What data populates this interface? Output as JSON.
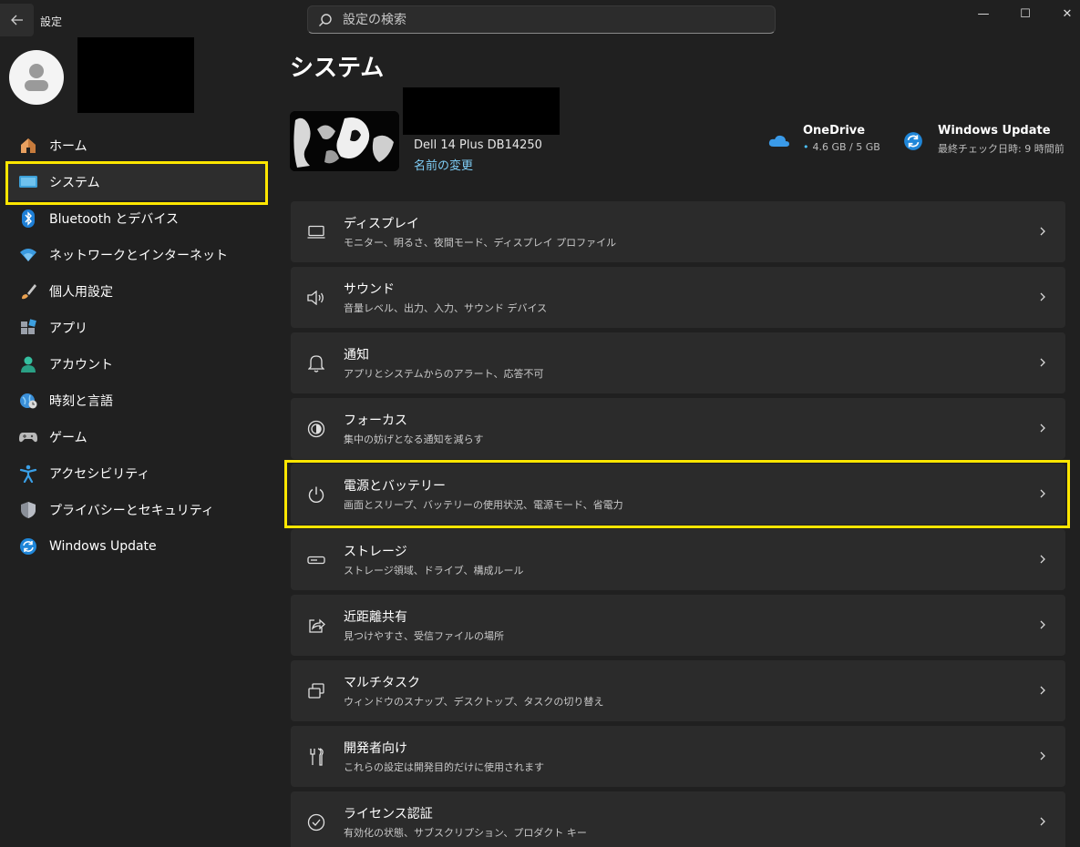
{
  "window": {
    "title": "設定",
    "controls": {
      "minimize": "—",
      "maximize": "☐",
      "close": "✕"
    }
  },
  "search": {
    "placeholder": "設定の検索"
  },
  "sidebar": {
    "items": [
      {
        "label": "ホーム",
        "icon": "home-icon"
      },
      {
        "label": "システム",
        "icon": "system-icon",
        "active": true
      },
      {
        "label": "Bluetooth とデバイス",
        "icon": "bluetooth-icon"
      },
      {
        "label": "ネットワークとインターネット",
        "icon": "wifi-icon"
      },
      {
        "label": "個人用設定",
        "icon": "brush-icon"
      },
      {
        "label": "アプリ",
        "icon": "apps-icon"
      },
      {
        "label": "アカウント",
        "icon": "account-icon"
      },
      {
        "label": "時刻と言語",
        "icon": "globe-icon"
      },
      {
        "label": "ゲーム",
        "icon": "gamepad-icon"
      },
      {
        "label": "アクセシビリティ",
        "icon": "accessibility-icon"
      },
      {
        "label": "プライバシーとセキュリティ",
        "icon": "shield-icon"
      },
      {
        "label": "Windows Update",
        "icon": "update-icon"
      }
    ]
  },
  "main": {
    "title": "システム",
    "device": {
      "name": "Dell 14 Plus DB14250",
      "rename_label": "名前の変更"
    },
    "onedrive": {
      "title": "OneDrive",
      "usage": "4.6 GB / 5 GB"
    },
    "windows_update": {
      "title": "Windows Update",
      "status": "最終チェック日時: 9 時間前"
    },
    "cards": [
      {
        "title": "ディスプレイ",
        "subtitle": "モニター、明るさ、夜間モード、ディスプレイ プロファイル",
        "icon": "display-icon"
      },
      {
        "title": "サウンド",
        "subtitle": "音量レベル、出力、入力、サウンド デバイス",
        "icon": "speaker-icon"
      },
      {
        "title": "通知",
        "subtitle": "アプリとシステムからのアラート、応答不可",
        "icon": "bell-icon"
      },
      {
        "title": "フォーカス",
        "subtitle": "集中の妨げとなる通知を減らす",
        "icon": "focus-icon"
      },
      {
        "title": "電源とバッテリー",
        "subtitle": "画面とスリープ、バッテリーの使用状況、電源モード、省電力",
        "icon": "power-icon"
      },
      {
        "title": "ストレージ",
        "subtitle": "ストレージ領域、ドライブ、構成ルール",
        "icon": "storage-icon"
      },
      {
        "title": "近距離共有",
        "subtitle": "見つけやすさ、受信ファイルの場所",
        "icon": "share-icon"
      },
      {
        "title": "マルチタスク",
        "subtitle": "ウィンドウのスナップ、デスクトップ、タスクの切り替え",
        "icon": "multitask-icon"
      },
      {
        "title": "開発者向け",
        "subtitle": "これらの設定は開発目的だけに使用されます",
        "icon": "developer-icon"
      },
      {
        "title": "ライセンス認証",
        "subtitle": "有効化の状態、サブスクリプション、プロダクト キー",
        "icon": "activation-icon"
      }
    ]
  },
  "colors": {
    "accent": "#4cc2ff",
    "highlight": "#ffe600",
    "background": "#202020",
    "card": "#2b2b2b"
  }
}
